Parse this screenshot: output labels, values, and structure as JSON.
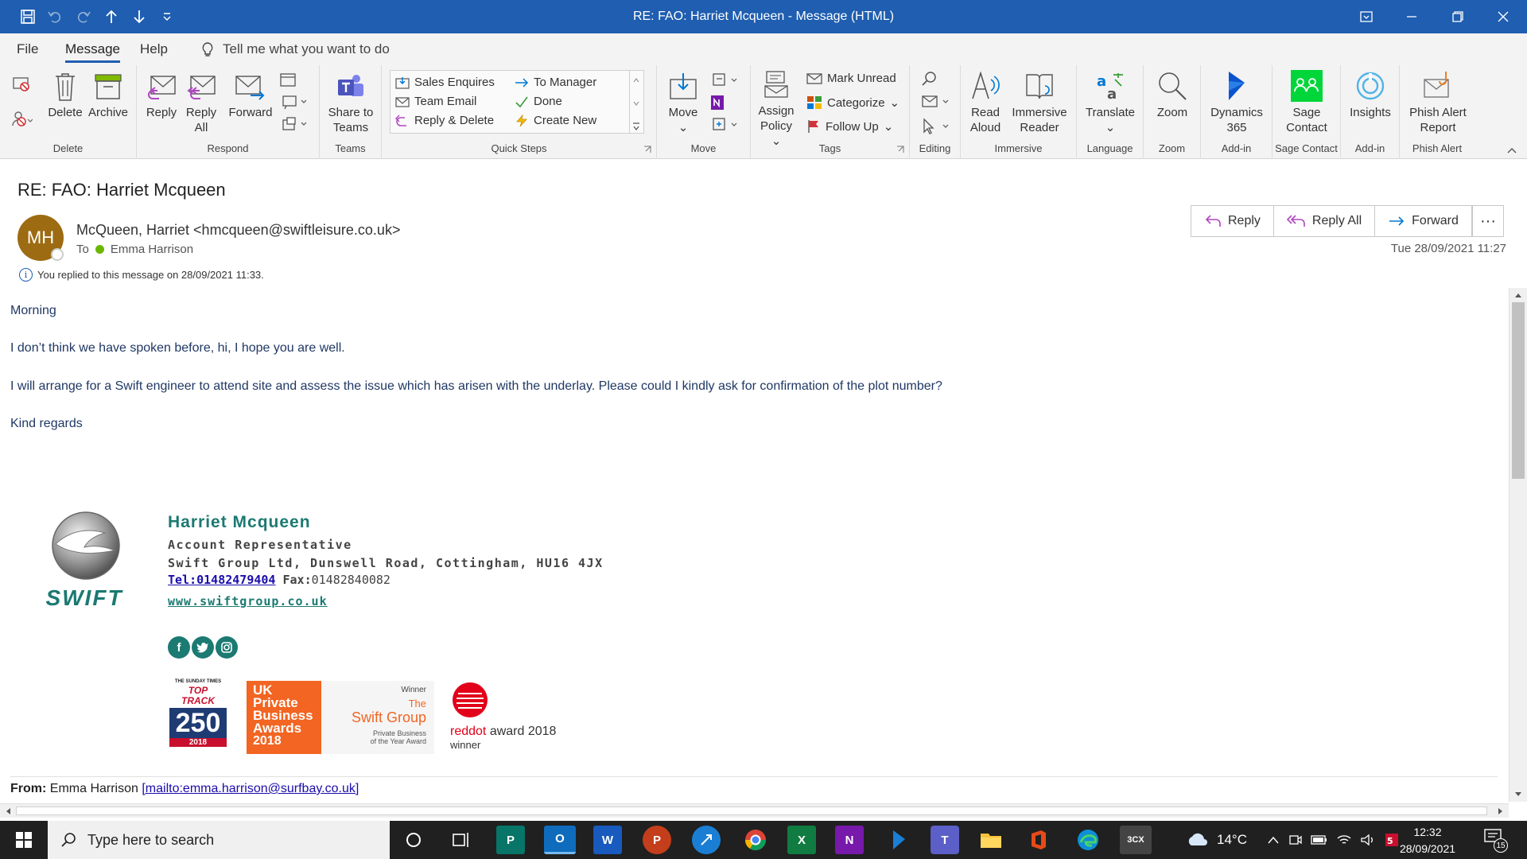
{
  "window": {
    "title": "RE: FAO: Harriet Mcqueen  -  Message (HTML)"
  },
  "menu": {
    "tabs": [
      "File",
      "Message",
      "Help"
    ],
    "tell_me": "Tell me what you want to do"
  },
  "ribbon": {
    "delete_group": {
      "label": "Delete",
      "delete": "Delete",
      "archive": "Archive"
    },
    "respond_group": {
      "label": "Respond",
      "reply": "Reply",
      "reply_all_1": "Reply",
      "reply_all_2": "All",
      "forward": "Forward"
    },
    "teams_group": {
      "label": "Teams",
      "share_1": "Share to",
      "share_2": "Teams"
    },
    "quick_steps": {
      "label": "Quick Steps",
      "items": [
        "Sales Enquires",
        "To Manager",
        "Team Email",
        "Done",
        "Reply & Delete",
        "Create New"
      ]
    },
    "move_group": {
      "label": "Move",
      "move": "Move"
    },
    "tags_group": {
      "label": "Tags",
      "assign_1": "Assign",
      "assign_2": "Policy",
      "mark_unread": "Mark Unread",
      "categorize": "Categorize",
      "follow_up": "Follow Up"
    },
    "editing_group": {
      "label": "Editing"
    },
    "immersive_group": {
      "label": "Immersive",
      "read_1": "Read",
      "read_2": "Aloud",
      "imm_1": "Immersive",
      "imm_2": "Reader"
    },
    "language_group": {
      "label": "Language",
      "translate": "Translate"
    },
    "zoom_group": {
      "label": "Zoom",
      "zoom": "Zoom"
    },
    "dynamics_group": {
      "label": "Add-in",
      "d_1": "Dynamics",
      "d_2": "365"
    },
    "sage_group": {
      "label": "Sage Contact",
      "s_1": "Sage",
      "s_2": "Contact"
    },
    "insights_group": {
      "label": "Add-in",
      "insights": "Insights"
    },
    "phish_group": {
      "label": "Phish Alert",
      "p_1": "Phish Alert",
      "p_2": "Report"
    }
  },
  "message": {
    "subject": "RE: FAO: Harriet Mcqueen",
    "avatar_initials": "MH",
    "sender": "McQueen, Harriet <hmcqueen@swiftleisure.co.uk>",
    "to_label": "To",
    "to_name": "Emma Harrison",
    "replied_note": "You replied to this message on 28/09/2021 11:33.",
    "date": "Tue 28/09/2021 11:27",
    "actions": {
      "reply": "Reply",
      "reply_all": "Reply All",
      "forward": "Forward",
      "more": "···"
    }
  },
  "body": {
    "p1": "Morning",
    "p2": "I don’t think we have spoken before, hi, I hope you are well.",
    "p3": "I will arrange for a Swift engineer to attend site and assess the issue which has arisen with the underlay.  Please could I kindly ask for confirmation of the plot number?",
    "p4": "Kind regards"
  },
  "signature": {
    "logo_text": "SWIFT",
    "name": "Harriet Mcqueen",
    "title": "Account Representative",
    "address": "Swift Group Ltd, Dunswell Road, Cottingham, HU16 4JX",
    "tel_label": "Tel:",
    "tel": "01482479404",
    "fax_label": "Fax:",
    "fax": "01482840082",
    "website": "www.swiftgroup.co.uk",
    "social": [
      "f",
      "t",
      "ig"
    ],
    "awards": {
      "a1_top": "THE SUNDAY TIMES",
      "a1_mid": "TOP TRACK",
      "a1_num": "250",
      "a1_year": "2018",
      "a2_line1": "UK",
      "a2_line2": "Private",
      "a2_line3": "Business",
      "a2_line4": "Awards",
      "a2_line5": "2018",
      "a3_winner": "Winner",
      "a3_the": "The",
      "a3_name": "Swift Group",
      "a3_sub1": "Private Business",
      "a3_sub2": "of the Year Award",
      "a4_red": "red",
      "a4_dot": "dot",
      "a4_award": " award 2018",
      "a4_winner": "winner"
    }
  },
  "from_line": {
    "label": "From:",
    "name": " Emma Harrison ",
    "link": "[mailto:emma.harrison@surfbay.co.uk]"
  },
  "taskbar": {
    "search_placeholder": "Type here to search",
    "weather": "14°C",
    "time": "12:32",
    "date": "28/09/2021",
    "notification_count": "15"
  },
  "colors": {
    "title_bar": "#1f5eb0",
    "body_text": "#1f3864",
    "signature_teal": "#1b7a72",
    "avatar": "#9c6b12"
  }
}
